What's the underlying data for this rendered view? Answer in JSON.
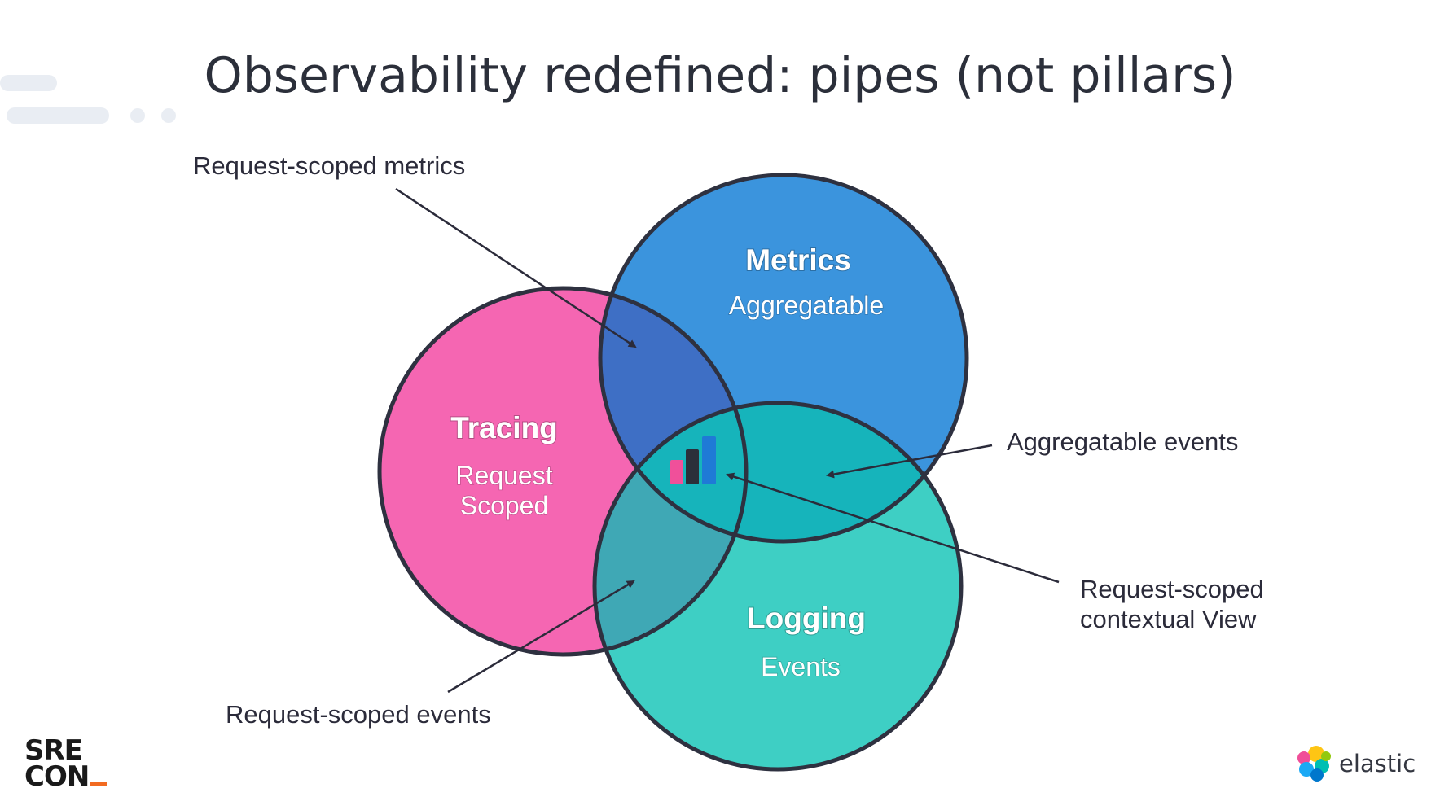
{
  "title": "Observability redefined: pipes (not pillars)",
  "circles": {
    "metrics": {
      "title": "Metrics",
      "subtitle": "Aggregatable",
      "color": "#3b94dd"
    },
    "tracing": {
      "title": "Tracing",
      "subtitle_lines": [
        "Request",
        "Scoped"
      ],
      "color": "#f566b2"
    },
    "logging": {
      "title": "Logging",
      "subtitle": "Events",
      "color": "#3ecfc4"
    }
  },
  "intersection_colors": {
    "tracing_metrics": "#3e6fc5",
    "metrics_logging": "#16b4bb",
    "tracing_logging": "#3fa8b5"
  },
  "callouts": {
    "request_scoped_metrics": "Request-scoped metrics",
    "aggregatable_events": "Aggregatable events",
    "request_scoped_view_lines": [
      "Request-scoped",
      "contextual View"
    ],
    "request_scoped_events": "Request-scoped events"
  },
  "branding": {
    "conference_lines": [
      "SRE",
      "CON"
    ],
    "conference_accent": "#f26b21",
    "vendor": "elastic"
  }
}
